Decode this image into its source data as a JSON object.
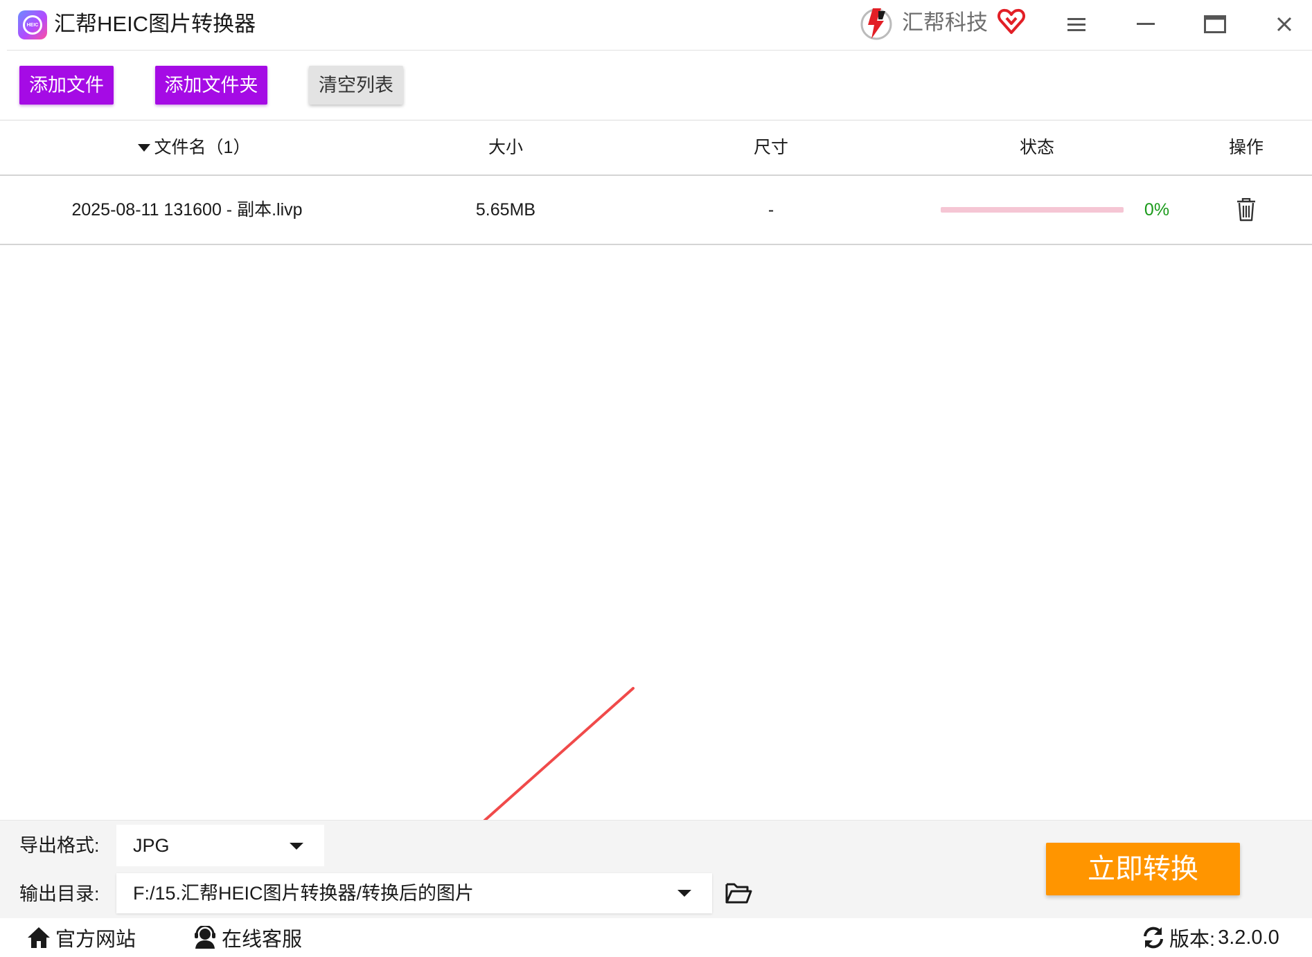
{
  "window": {
    "title": "汇帮HEIC图片转换器",
    "brand": "汇帮科技",
    "logo_text": "HEIC"
  },
  "toolbar": {
    "add_file": "添加文件",
    "add_folder": "添加文件夹",
    "clear_list": "清空列表"
  },
  "table": {
    "headers": {
      "filename": "文件名（1）",
      "size": "大小",
      "dimensions": "尺寸",
      "status": "状态",
      "action": "操作"
    },
    "rows": [
      {
        "filename": "2025-08-11 131600 - 副本.livp",
        "size": "5.65MB",
        "dimensions": "-",
        "progress": 0,
        "progress_text": "0%"
      }
    ]
  },
  "settings": {
    "format_label": "导出格式:",
    "format_value": "JPG",
    "output_label": "输出目录:",
    "output_value": "F:/15.汇帮HEIC图片转换器/转换后的图片",
    "convert_button": "立即转换"
  },
  "statusbar": {
    "website": "官方网站",
    "support": "在线客服",
    "version_label": "版本:",
    "version_value": "3.2.0.0"
  },
  "colors": {
    "primary_button": "#a50be5",
    "convert_button": "#ff9500",
    "progress_track": "#f5c6d4",
    "progress_text": "#1a9a1a",
    "annotation_arrow": "#f04a4a"
  },
  "icons": [
    "app-logo-icon",
    "brand-logo-icon",
    "heart-icon",
    "menu-icon",
    "minimize-icon",
    "maximize-icon",
    "close-icon",
    "sort-desc-icon",
    "trash-icon",
    "chevron-down-icon",
    "folder-open-icon",
    "home-icon",
    "headset-icon",
    "refresh-icon"
  ]
}
